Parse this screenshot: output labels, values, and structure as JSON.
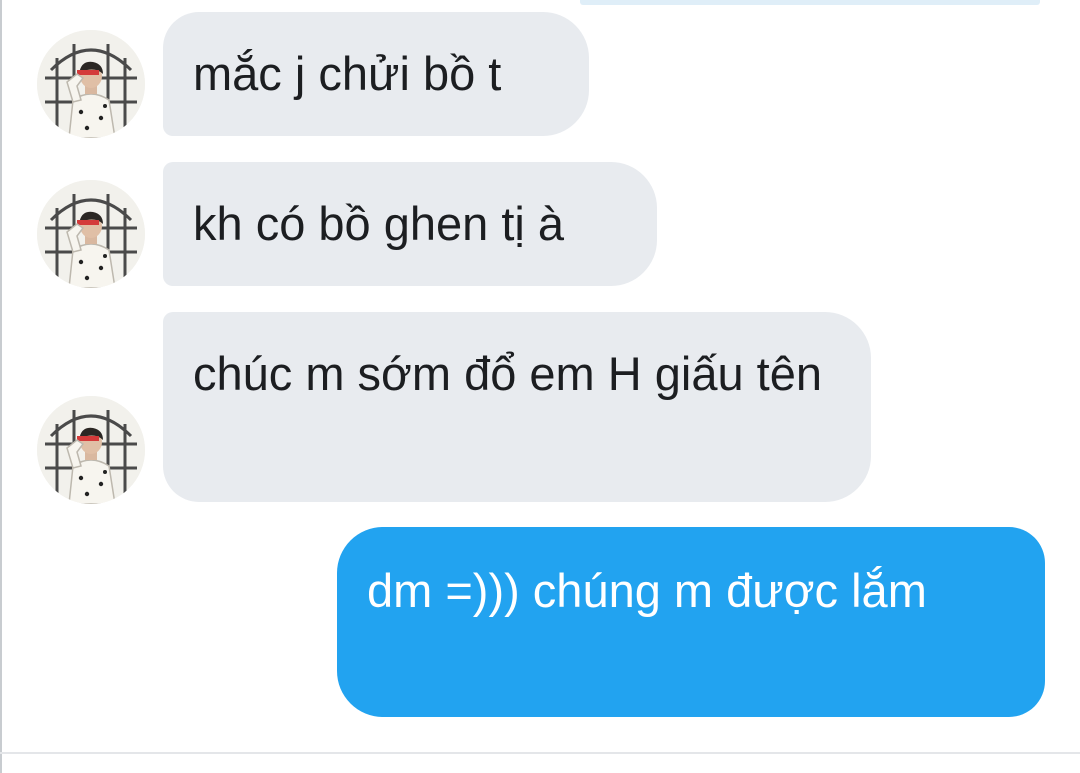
{
  "conversation": {
    "messages": [
      {
        "direction": "incoming",
        "text": "mắc j chửi bồ t",
        "has_avatar": true
      },
      {
        "direction": "incoming",
        "text": "kh có bồ ghen tị à",
        "has_avatar": true
      },
      {
        "direction": "incoming",
        "text": "chúc m sớm đổ em H giấu tên",
        "has_avatar": true
      },
      {
        "direction": "outgoing",
        "text": "dm =))) chúng m được lắm",
        "has_avatar": false
      }
    ]
  },
  "contact": {
    "avatar_icon": "person-saluting-avatar"
  },
  "colors": {
    "incoming_bubble": "#e8ebef",
    "outgoing_bubble": "#22a3f0",
    "incoming_text": "#1c1e21",
    "outgoing_text": "#ffffff",
    "background": "#ffffff"
  }
}
